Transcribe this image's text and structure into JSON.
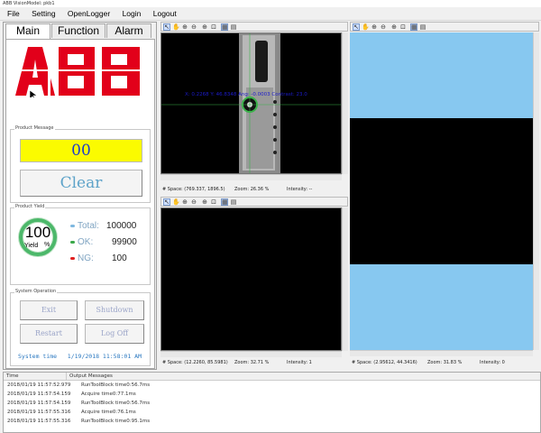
{
  "window": {
    "title": "ABB VisionModel: pkb1"
  },
  "menu": [
    "File",
    "Setting",
    "OpenLogger",
    "Login",
    "Logout"
  ],
  "tabs": [
    "Main",
    "Function",
    "Alarm"
  ],
  "logo": {
    "text": "ABB",
    "color": "#e2001a"
  },
  "product_message": {
    "label": "Product Message",
    "code": "00",
    "clear_label": "Clear"
  },
  "product_yield": {
    "label": "Product Yield",
    "percent": "100",
    "yield_label": "Yield",
    "percent_sign": "%",
    "total_label": "Total:",
    "total": "100000",
    "ok_label": "OK:",
    "ok": "99900",
    "ng_label": "NG:",
    "ng": "100"
  },
  "system_operation": {
    "label": "System Operation",
    "exit": "Exit",
    "shutdown": "Shutdown",
    "restart": "Restart",
    "logoff": "Log Off",
    "time_label": "System time",
    "time": "1/19/2018 11:58:01 AM"
  },
  "view1": {
    "overlay": "X: 0.2268 Y: 46.8348 Ang: -0.0003 Contrast: 23.0",
    "space": "# Space: (769.337, 1896.5)",
    "zoom": "Zoom: 26.36 %",
    "intensity": "Intensity: --"
  },
  "view2": {
    "space": "# Space: (12.2260, 85.5981)",
    "zoom": "Zoom: 32.71 %",
    "intensity": "Intensity: 1"
  },
  "view3": {
    "space": "# Space: (2.95612, 44.3416)",
    "zoom": "Zoom: 31.83 %",
    "intensity": "Intensity: 0"
  },
  "log": {
    "col_time": "Time",
    "col_msg": "Output Messages",
    "rows": [
      {
        "time": "2018/01/19 11:57:52.979",
        "msg": "RunToolBlock time0:56.7ms"
      },
      {
        "time": "2018/01/19 11:57:54.159",
        "msg": "Acquire time0:77.1ms"
      },
      {
        "time": "2018/01/19 11:57:54.159",
        "msg": "RunToolBlock time0:56.7ms"
      },
      {
        "time": "2018/01/19 11:57:55.316",
        "msg": "Acquire time0:76.1ms"
      },
      {
        "time": "2018/01/19 11:57:55.316",
        "msg": "RunToolBlock time0:95.1ms"
      }
    ]
  },
  "colors": {
    "message_bg": "#fbfb00",
    "message_text": "#1a3ccc",
    "button_text": "#5ea3c9",
    "ok_dot": "#3aa84a",
    "ng_dot": "#e02020",
    "total_dot": "#7fb8e0",
    "viewport_bg": "#87c8f0",
    "overlay_text": "#1c1ccc",
    "time_text": "#2a78c0"
  },
  "icons": [
    "pointer-icon",
    "pan-icon",
    "zoom-in-icon",
    "zoom-out-icon",
    "zoom-fit-icon",
    "zoom-region-icon",
    "grid-icon",
    "table-icon"
  ]
}
